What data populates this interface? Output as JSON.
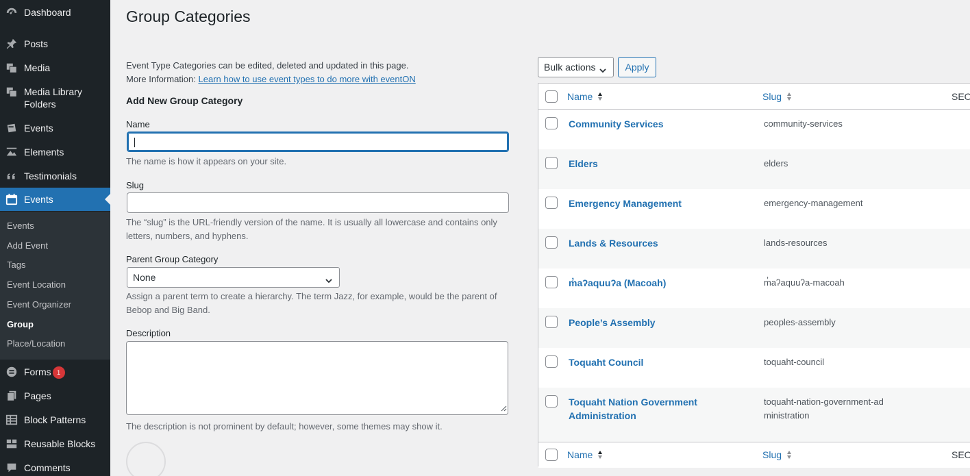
{
  "sidebar": {
    "items": [
      {
        "label": "Dashboard",
        "icon": "dashboard-icon"
      },
      {
        "label": "Posts",
        "icon": "pin-icon"
      },
      {
        "label": "Media",
        "icon": "media-icon"
      },
      {
        "label": "Media Library Folders",
        "icon": "media-folders-icon"
      },
      {
        "label": "Events",
        "icon": "events-icon"
      },
      {
        "label": "Elements",
        "icon": "elements-icon"
      },
      {
        "label": "Testimonials",
        "icon": "quote-icon"
      },
      {
        "label": "Events",
        "icon": "calendar-icon"
      },
      {
        "label": "Forms",
        "icon": "forms-icon",
        "badge": "1"
      },
      {
        "label": "Pages",
        "icon": "pages-icon"
      },
      {
        "label": "Block Patterns",
        "icon": "grid-icon"
      },
      {
        "label": "Reusable Blocks",
        "icon": "blocks-icon"
      },
      {
        "label": "Comments",
        "icon": "comment-icon"
      }
    ],
    "submenu": [
      "Events",
      "Add Event",
      "Tags",
      "Event Location",
      "Event Organizer",
      "Group",
      "Place/Location"
    ]
  },
  "page": {
    "title": "Group Categories",
    "intro_line1": "Event Type Categories can be edited, deleted and updated in this page.",
    "intro_line2_prefix": "More Information: ",
    "intro_link": "Learn how to use event types to do more with eventON"
  },
  "form": {
    "heading": "Add New Group Category",
    "name_label": "Name",
    "name_value": "",
    "name_help": "The name is how it appears on your site.",
    "slug_label": "Slug",
    "slug_value": "",
    "slug_help": "The “slug” is the URL-friendly version of the name. It is usually all lowercase and contains only letters, numbers, and hyphens.",
    "parent_label": "Parent Group Category",
    "parent_selected": "None",
    "parent_help": "Assign a parent term to create a hierarchy. The term Jazz, for example, would be the parent of Bebop and Big Band.",
    "description_label": "Description",
    "description_value": "",
    "description_help": "The description is not prominent by default; however, some themes may show it."
  },
  "table": {
    "bulk_actions": "Bulk actions",
    "apply": "Apply",
    "col_name": "Name",
    "col_slug": "Slug",
    "col_seo": "SEO",
    "rows": [
      {
        "name": "Community Services",
        "slug": "community-services"
      },
      {
        "name": "Elders",
        "slug": "elders"
      },
      {
        "name": "Emergency Management",
        "slug": "emergency-management"
      },
      {
        "name": "Lands & Resources",
        "slug": "lands-resources"
      },
      {
        "name": "m̓aʔaquuʔa (Macoah)",
        "slug": "m̓aʔaquuʔa-macoah"
      },
      {
        "name": "People’s Assembly",
        "slug": "peoples-assembly"
      },
      {
        "name": "Toquaht Council",
        "slug": "toquaht-council"
      },
      {
        "name": "Toquaht Nation Government Administration",
        "slug": "toquaht-nation-government-administration"
      }
    ]
  },
  "colors": {
    "sidebar_bg": "#1d2327",
    "accent": "#2271b1",
    "badge": "#d63638"
  }
}
